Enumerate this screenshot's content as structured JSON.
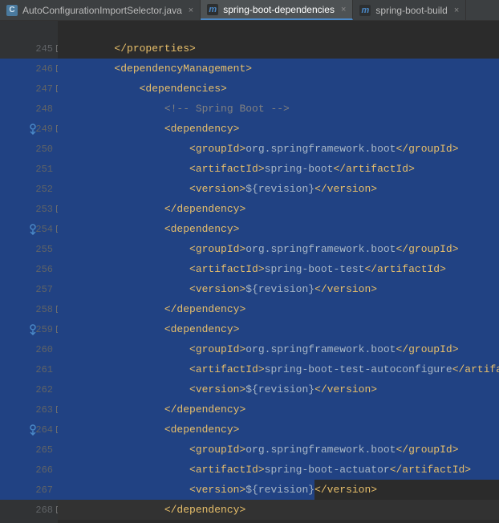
{
  "tabs": [
    {
      "label": "AutoConfigurationImportSelector.java",
      "active": false,
      "iconType": "class",
      "iconGlyph": "C"
    },
    {
      "label": "spring-boot-dependencies",
      "active": true,
      "iconType": "maven",
      "iconGlyph": "m"
    },
    {
      "label": "spring-boot-build",
      "active": false,
      "iconType": "maven",
      "iconGlyph": "m"
    }
  ],
  "code": {
    "startLine": 245,
    "lines": [
      {
        "n": 245,
        "indent": 1,
        "selected": false,
        "fold": "close",
        "tokens": [
          {
            "t": "tag",
            "v": "</properties>"
          }
        ]
      },
      {
        "n": 246,
        "indent": 1,
        "selected": true,
        "fold": "open",
        "tokens": [
          {
            "t": "tag",
            "v": "<dependencyManagement>"
          }
        ]
      },
      {
        "n": 247,
        "indent": 2,
        "selected": true,
        "fold": "open",
        "tokens": [
          {
            "t": "tag",
            "v": "<dependencies>"
          }
        ]
      },
      {
        "n": 248,
        "indent": 3,
        "selected": true,
        "tokens": [
          {
            "t": "comment",
            "v": "<!-- Spring Boot -->"
          }
        ]
      },
      {
        "n": 249,
        "indent": 3,
        "selected": true,
        "fold": "open",
        "gutterIcon": "impl",
        "tokens": [
          {
            "t": "tag",
            "v": "<dependency>"
          }
        ]
      },
      {
        "n": 250,
        "indent": 4,
        "selected": true,
        "tokens": [
          {
            "t": "tag",
            "v": "<groupId>"
          },
          {
            "t": "text",
            "v": "org.springframework.boot"
          },
          {
            "t": "tag",
            "v": "</groupId>"
          }
        ]
      },
      {
        "n": 251,
        "indent": 4,
        "selected": true,
        "tokens": [
          {
            "t": "tag",
            "v": "<artifactId>"
          },
          {
            "t": "text",
            "v": "spring-boot"
          },
          {
            "t": "tag",
            "v": "</artifactId>"
          }
        ]
      },
      {
        "n": 252,
        "indent": 4,
        "selected": true,
        "tokens": [
          {
            "t": "tag",
            "v": "<version>"
          },
          {
            "t": "var",
            "v": "${revision}"
          },
          {
            "t": "tag",
            "v": "</version>"
          }
        ]
      },
      {
        "n": 253,
        "indent": 3,
        "selected": true,
        "fold": "close",
        "tokens": [
          {
            "t": "tag",
            "v": "</dependency>"
          }
        ]
      },
      {
        "n": 254,
        "indent": 3,
        "selected": true,
        "fold": "open",
        "gutterIcon": "impl",
        "tokens": [
          {
            "t": "tag",
            "v": "<dependency>"
          }
        ]
      },
      {
        "n": 255,
        "indent": 4,
        "selected": true,
        "tokens": [
          {
            "t": "tag",
            "v": "<groupId>"
          },
          {
            "t": "text",
            "v": "org.springframework.boot"
          },
          {
            "t": "tag",
            "v": "</groupId>"
          }
        ]
      },
      {
        "n": 256,
        "indent": 4,
        "selected": true,
        "tokens": [
          {
            "t": "tag",
            "v": "<artifactId>"
          },
          {
            "t": "text",
            "v": "spring-boot-test"
          },
          {
            "t": "tag",
            "v": "</artifactId>"
          }
        ]
      },
      {
        "n": 257,
        "indent": 4,
        "selected": true,
        "tokens": [
          {
            "t": "tag",
            "v": "<version>"
          },
          {
            "t": "var",
            "v": "${revision}"
          },
          {
            "t": "tag",
            "v": "</version>"
          }
        ]
      },
      {
        "n": 258,
        "indent": 3,
        "selected": true,
        "fold": "close",
        "tokens": [
          {
            "t": "tag",
            "v": "</dependency>"
          }
        ]
      },
      {
        "n": 259,
        "indent": 3,
        "selected": true,
        "fold": "open",
        "gutterIcon": "impl",
        "tokens": [
          {
            "t": "tag",
            "v": "<dependency>"
          }
        ]
      },
      {
        "n": 260,
        "indent": 4,
        "selected": true,
        "tokens": [
          {
            "t": "tag",
            "v": "<groupId>"
          },
          {
            "t": "text",
            "v": "org.springframework.boot"
          },
          {
            "t": "tag",
            "v": "</groupId>"
          }
        ]
      },
      {
        "n": 261,
        "indent": 4,
        "selected": true,
        "tokens": [
          {
            "t": "tag",
            "v": "<artifactId>"
          },
          {
            "t": "text",
            "v": "spring-boot-test-autoconfigure"
          },
          {
            "t": "tag",
            "v": "</artifactId>"
          }
        ]
      },
      {
        "n": 262,
        "indent": 4,
        "selected": true,
        "tokens": [
          {
            "t": "tag",
            "v": "<version>"
          },
          {
            "t": "var",
            "v": "${revision}"
          },
          {
            "t": "tag",
            "v": "</version>"
          }
        ]
      },
      {
        "n": 263,
        "indent": 3,
        "selected": true,
        "fold": "close",
        "tokens": [
          {
            "t": "tag",
            "v": "</dependency>"
          }
        ]
      },
      {
        "n": 264,
        "indent": 3,
        "selected": true,
        "fold": "open",
        "gutterIcon": "impl",
        "tokens": [
          {
            "t": "tag",
            "v": "<dependency>"
          }
        ]
      },
      {
        "n": 265,
        "indent": 4,
        "selected": true,
        "tokens": [
          {
            "t": "tag",
            "v": "<groupId>"
          },
          {
            "t": "text",
            "v": "org.springframework.boot"
          },
          {
            "t": "tag",
            "v": "</groupId>"
          }
        ]
      },
      {
        "n": 266,
        "indent": 4,
        "selected": true,
        "tokens": [
          {
            "t": "tag",
            "v": "<artifactId>"
          },
          {
            "t": "text",
            "v": "spring-boot-actuator"
          },
          {
            "t": "tag",
            "v": "</artifactId>"
          }
        ]
      },
      {
        "n": 267,
        "indent": 4,
        "selected": "partial",
        "partialEndTokenIndex": 1,
        "tokens": [
          {
            "t": "tag",
            "v": "<version>"
          },
          {
            "t": "var",
            "v": "${revision}"
          },
          {
            "t": "tag",
            "v": "</version>"
          }
        ]
      },
      {
        "n": 268,
        "indent": 3,
        "selected": false,
        "fold": "close",
        "caretLine": true,
        "tokens": [
          {
            "t": "tag",
            "v": "</dependency>"
          }
        ]
      }
    ]
  },
  "glyphs": {
    "foldOpen": "⊟",
    "foldClose": "⊟",
    "close": "×"
  }
}
